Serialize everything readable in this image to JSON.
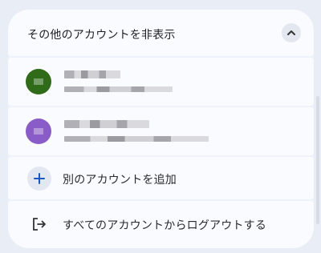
{
  "header": {
    "label": "その他のアカウントを非表示",
    "toggle_icon": "chevron-up-icon"
  },
  "accounts": [
    {
      "avatar_color": "#2f6b19"
    },
    {
      "avatar_color": "#8a5cc7"
    }
  ],
  "actions": {
    "add_account": "別のアカウントを追加",
    "add_icon": "plus-icon",
    "logout_all": "すべてのアカウントからログアウトする",
    "logout_icon": "logout-icon"
  }
}
